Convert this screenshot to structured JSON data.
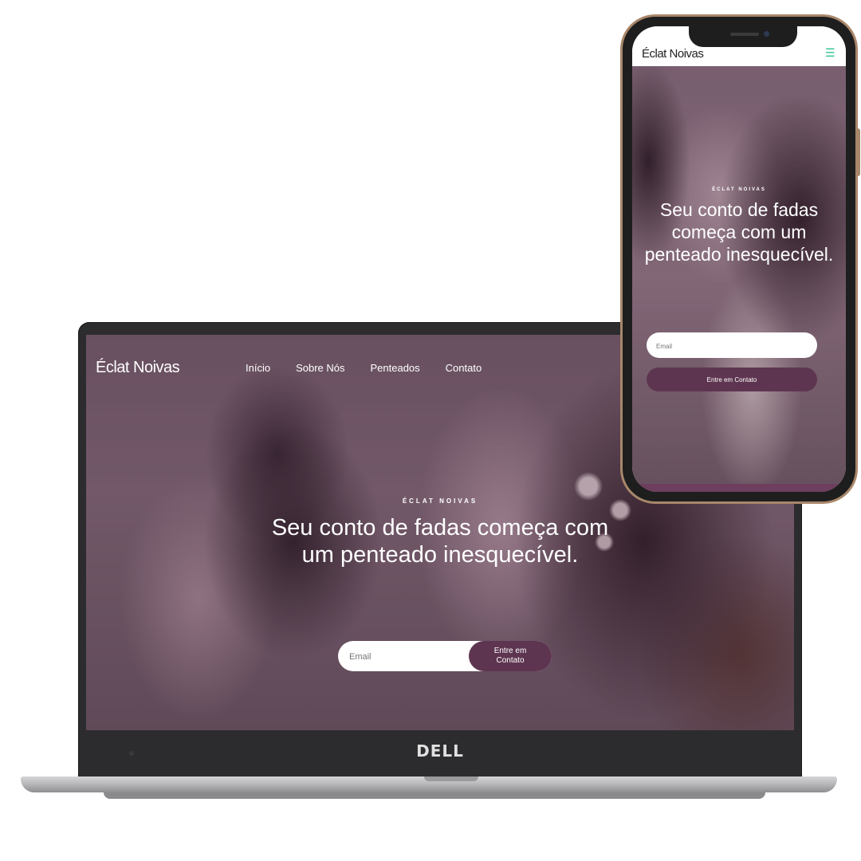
{
  "laptop": {
    "brand_logo": "DELL",
    "site": {
      "brand": "Éclat Noivas",
      "nav": [
        "Início",
        "Sobre Nós",
        "Penteados",
        "Contato"
      ],
      "eyebrow": "ÉCLAT NOIVAS",
      "headline": "Seu conto de fadas começa com um penteado inesquecível.",
      "email_placeholder": "Email",
      "cta_label": "Entre em Contato"
    }
  },
  "phone": {
    "site": {
      "brand": "Éclat Noivas",
      "menu_icon": "hamburger-icon",
      "eyebrow": "ÉCLAT NOIVAS",
      "headline": "Seu conto de fadas começa com um penteado inesquecível.",
      "email_placeholder": "Email",
      "cta_label": "Entre em Contato"
    }
  },
  "colors": {
    "brand_plum": "#5e3550",
    "menu_icon_green": "#2fbf8f",
    "phone_frame_gold": "#a8876a"
  }
}
